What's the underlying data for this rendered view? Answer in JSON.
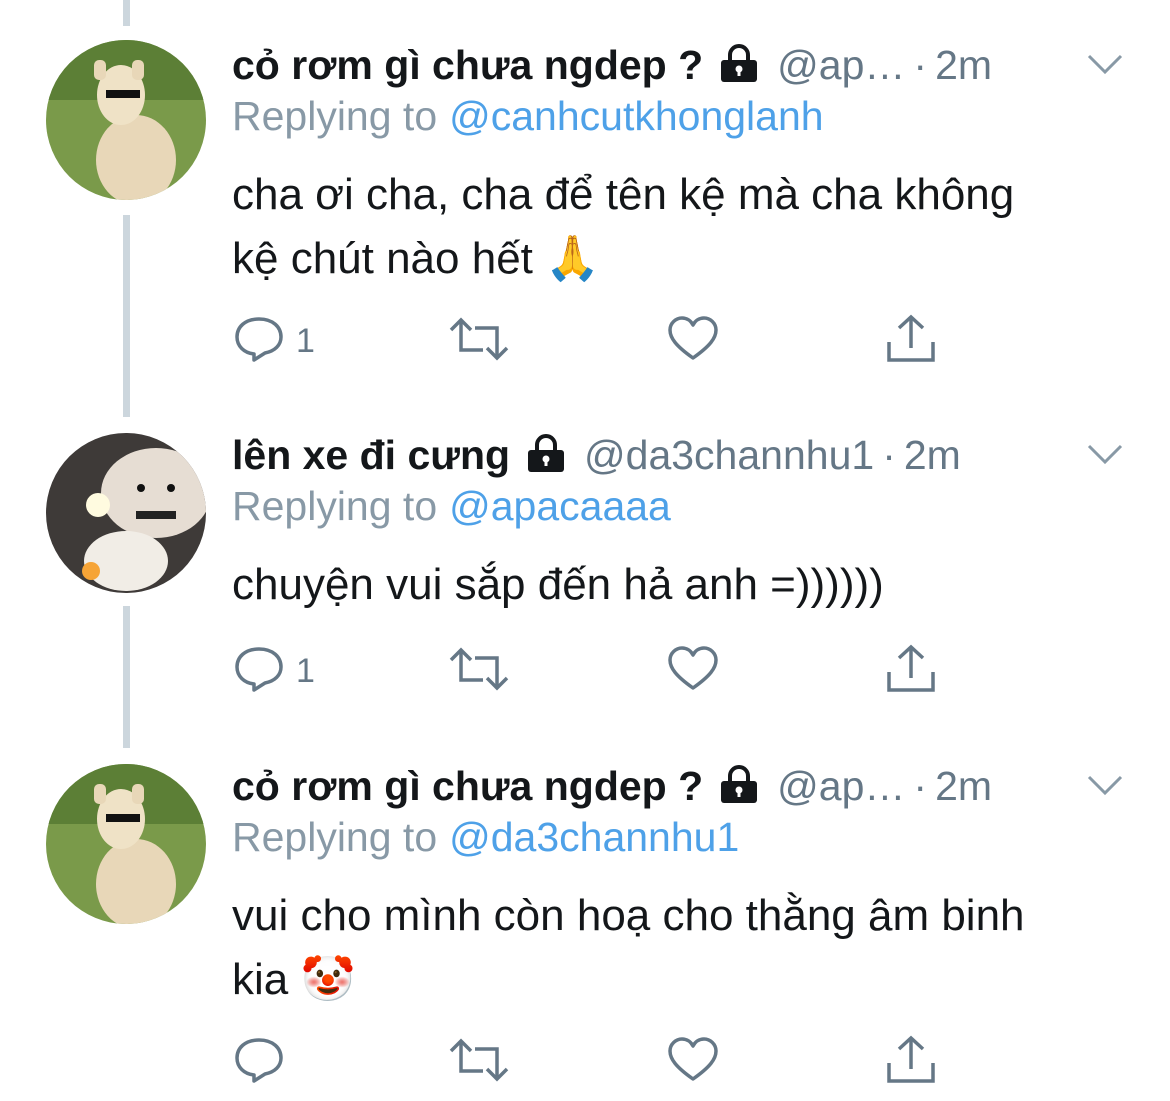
{
  "colors": {
    "name": "#14171a",
    "muted": "#657786",
    "mention": "#4ea1e8",
    "thread_line": "#ccd6dd",
    "icon": "#657786"
  },
  "tweets": [
    {
      "name": "cỏ rơm gì chưa ngdep ?",
      "handle": "@ap…",
      "separator": "·",
      "time": "2m",
      "replying_label": "Replying to",
      "replying_to": "@canhcutkhonglanh",
      "text_line1": "cha ơi cha, cha để tên kệ mà cha không",
      "text_line2": "kệ chút nào hết",
      "emoji": "🙏",
      "reply_count": "1",
      "avatar_icon": "alpaca-avatar"
    },
    {
      "name": "lên xe đi cưng",
      "handle": "@da3channhu1",
      "separator": "·",
      "time": "2m",
      "replying_label": "Replying to",
      "replying_to": "@apacaaaa",
      "text_line1": "chuyện vui sắp đến hả anh =))))))",
      "reply_count": "1",
      "avatar_icon": "hamster-avatar"
    },
    {
      "name": "cỏ rơm gì chưa ngdep ?",
      "handle": "@ap…",
      "separator": "·",
      "time": "2m",
      "replying_label": "Replying to",
      "replying_to": "@da3channhu1",
      "text_line1": "vui cho mình còn hoạ cho thằng âm binh",
      "text_line2": "kia",
      "emoji": "🤡",
      "reply_count": "",
      "avatar_icon": "alpaca-avatar"
    }
  ]
}
